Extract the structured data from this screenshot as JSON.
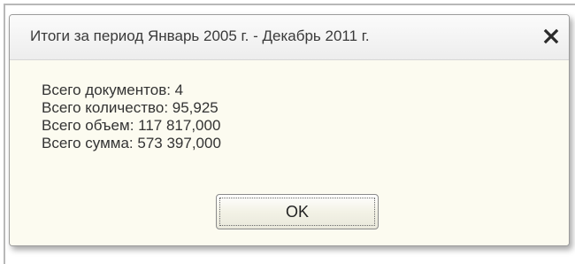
{
  "dialog": {
    "title": "Итоги за период Январь 2005 г. - Декабрь 2011 г.",
    "close_icon": "close-icon",
    "lines": [
      "Всего документов: 4",
      "Всего количество: 95,925",
      "Всего объем: 117 817,000",
      "Всего сумма: 573 397,000"
    ],
    "ok_label": "OK"
  },
  "colors": {
    "dialog_background": "#fcfbf0",
    "titlebar_top": "#fbfbfb",
    "titlebar_bottom": "#ededed",
    "text": "#333333"
  }
}
